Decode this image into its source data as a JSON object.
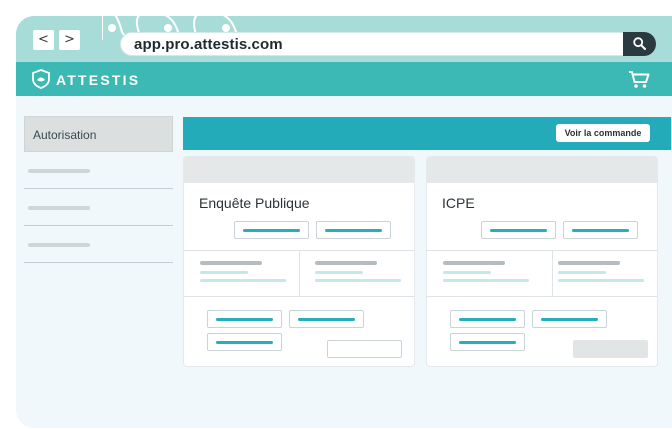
{
  "browser": {
    "back_label": "<",
    "forward_label": ">",
    "url": "app.pro.attestis.com"
  },
  "app": {
    "brand": "ATTESTIS"
  },
  "sidebar": {
    "active_label": "Autorisation"
  },
  "toolbar": {
    "order_button_label": "Voir la commande"
  },
  "cards": [
    {
      "title": "Enquête Publique"
    },
    {
      "title": "ICPE"
    }
  ],
  "colors": {
    "browser_chrome": "#a8dcd9",
    "app_bar": "#3cb8b5",
    "accent": "#24abba",
    "search_button": "#2b3a40"
  }
}
